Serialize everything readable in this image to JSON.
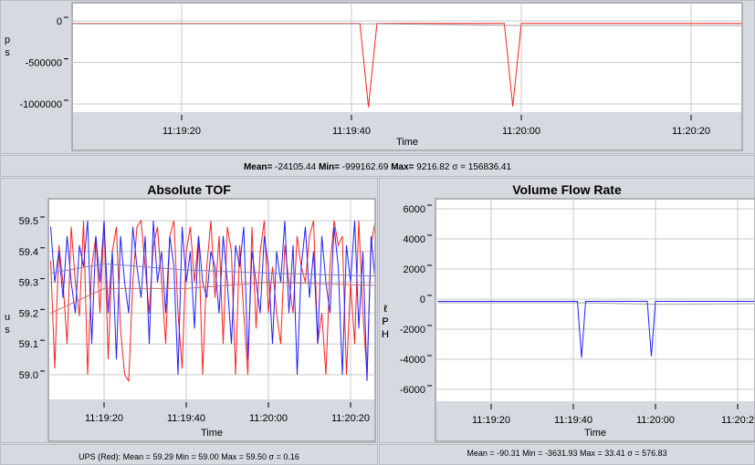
{
  "top_chart": {
    "ylabel": [
      "p",
      "s"
    ],
    "xlabel": "Time",
    "yticks": [
      {
        "v": 0,
        "label": "0"
      },
      {
        "v": -500000,
        "label": "-500000"
      },
      {
        "v": -1000000,
        "label": "-1000000"
      }
    ],
    "xticks": [
      "11:19:20",
      "11:19:40",
      "11:20:00",
      "11:20:20"
    ],
    "stats": {
      "mean_label": "Mean=",
      "mean": "-24105.44",
      "min_label": "Min=",
      "min": "-999162.69",
      "max_label": "Max=",
      "max": "9216.82",
      "sigma_label": "σ =",
      "sigma": "156836.41"
    }
  },
  "tof_chart": {
    "title": "Absolute TOF",
    "ylabel": [
      "u",
      "s"
    ],
    "xlabel": "Time",
    "yticks": [
      {
        "v": 59.5,
        "label": "59.5"
      },
      {
        "v": 59.4,
        "label": "59.4"
      },
      {
        "v": 59.3,
        "label": "59.3"
      },
      {
        "v": 59.2,
        "label": "59.2"
      },
      {
        "v": 59.1,
        "label": "59.1"
      },
      {
        "v": 59.0,
        "label": "59.0"
      }
    ],
    "xticks": [
      "11:19:20",
      "11:19:40",
      "11:20:00",
      "11:20:20"
    ],
    "stats": {
      "series_label": "UPS (Red):",
      "text": "Mean = 59.29 Min = 59.00 Max = 59.50 σ = 0.16"
    }
  },
  "vfr_chart": {
    "title": "Volume Flow Rate",
    "ylabel": [
      "ℓ",
      "P",
      "H"
    ],
    "xlabel": "Time",
    "yticks": [
      {
        "v": 6000,
        "label": "6000"
      },
      {
        "v": 4000,
        "label": "4000"
      },
      {
        "v": 2000,
        "label": "2000"
      },
      {
        "v": 0,
        "label": "0"
      },
      {
        "v": -2000,
        "label": "-2000"
      },
      {
        "v": -4000,
        "label": "-4000"
      },
      {
        "v": -6000,
        "label": "-6000"
      }
    ],
    "xticks": [
      "11:19:20",
      "11:19:40",
      "11:20:00",
      "11:20:2"
    ],
    "stats": {
      "text": "Mean = -90.31 Min = -3631.93 Max = 33.41 σ = 576.83"
    }
  },
  "chart_data": [
    {
      "type": "line",
      "xlabel": "Time",
      "ylabel": "ps",
      "start": "11:19:07",
      "series": [
        {
          "color": "#ff2020",
          "points": [
            [
              "11:19:07",
              -30000
            ],
            [
              "11:19:41",
              -30000
            ],
            [
              "11:19:42",
              -1040000
            ],
            [
              "11:19:43",
              -30000
            ],
            [
              "11:19:58",
              -30000
            ],
            [
              "11:19:59",
              -1030000
            ],
            [
              "11:20:00",
              -30000
            ],
            [
              "11:20:26",
              -30000
            ]
          ]
        },
        {
          "color": "#a0a0a0",
          "points": [
            [
              "11:19:07",
              -35000
            ],
            [
              "11:19:43",
              -35000
            ],
            [
              "11:20:00",
              -55000
            ],
            [
              "11:20:26",
              -55000
            ]
          ]
        }
      ]
    },
    {
      "type": "line",
      "title": "Absolute TOF",
      "xlabel": "Time",
      "ylabel": "us",
      "start": "11:19:07",
      "series": [
        {
          "name": "UPS (Red)",
          "color": "#ff2020",
          "values": [
            59.37,
            59.02,
            59.42,
            59.3,
            59.1,
            59.48,
            59.3,
            59.19,
            59.5,
            59.0,
            59.35,
            59.45,
            59.2,
            59.5,
            59.05,
            59.4,
            59.48,
            59.15,
            59.0,
            58.98,
            59.3,
            59.48,
            59.5,
            59.35,
            59.2,
            59.42,
            59.48,
            59.3,
            59.1,
            59.45,
            59.5,
            59.2,
            59.02,
            59.4,
            59.48,
            59.3,
            59.45,
            59.0,
            59.35,
            59.5,
            59.25,
            59.45,
            59.1,
            59.48,
            59.4,
            59.0,
            59.42,
            59.2,
            59.0,
            59.48,
            59.15,
            59.4,
            59.5,
            59.2,
            59.35,
            59.2,
            59.1,
            59.42,
            59.3,
            59.2,
            59.45,
            59.35,
            59.3,
            59.45,
            59.5,
            59.1,
            59.2,
            59.0,
            59.35,
            59.5,
            59.42,
            59.45,
            59.0,
            59.3,
            59.1,
            59.5,
            59.2,
            59.0,
            59.42,
            59.5
          ]
        },
        {
          "color": "#2020ff",
          "values": [
            59.48,
            59.3,
            59.4,
            59.25,
            59.45,
            59.3,
            59.2,
            59.42,
            59.35,
            59.5,
            59.1,
            59.45,
            59.3,
            59.5,
            59.2,
            59.4,
            59.05,
            59.45,
            59.3,
            59.2,
            59.48,
            59.35,
            59.25,
            59.45,
            59.1,
            59.5,
            59.3,
            59.4,
            59.2,
            59.45,
            59.35,
            59.0,
            59.48,
            59.3,
            59.4,
            59.15,
            59.45,
            59.3,
            59.25,
            59.4,
            59.35,
            59.2,
            59.45,
            59.3,
            59.1,
            59.42,
            59.35,
            59.48,
            59.05,
            59.4,
            59.3,
            59.2,
            59.45,
            59.35,
            59.1,
            59.4,
            59.3,
            59.5,
            59.2,
            59.42,
            59.0,
            59.35,
            59.48,
            59.25,
            59.4,
            59.1,
            59.45,
            59.3,
            59.2,
            59.48,
            59.35,
            59.0,
            59.42,
            59.3,
            59.5,
            59.15,
            59.4,
            58.98,
            59.45,
            59.3
          ]
        },
        {
          "color": "#c07070",
          "points": [
            [
              "11:19:07",
              59.2
            ],
            [
              "11:19:20",
              59.28
            ],
            [
              "11:19:40",
              59.28
            ],
            [
              "11:20:00",
              59.3
            ],
            [
              "11:20:26",
              59.29
            ]
          ]
        },
        {
          "color": "#8080c0",
          "points": [
            [
              "11:19:07",
              59.33
            ],
            [
              "11:19:20",
              59.36
            ],
            [
              "11:19:40",
              59.34
            ],
            [
              "11:20:00",
              59.33
            ],
            [
              "11:20:26",
              59.32
            ]
          ]
        }
      ]
    },
    {
      "type": "line",
      "title": "Volume Flow Rate",
      "xlabel": "Time",
      "ylabel": "ℓPH",
      "start": "11:19:07",
      "series": [
        {
          "color": "#a0a0a0",
          "points": [
            [
              "11:19:07",
              -250
            ],
            [
              "11:19:43",
              -250
            ],
            [
              "11:20:00",
              -350
            ],
            [
              "11:20:26",
              -300
            ]
          ]
        },
        {
          "color": "#2020ff",
          "points": [
            [
              "11:19:07",
              -150
            ],
            [
              "11:19:41",
              -150
            ],
            [
              "11:19:42",
              -3900
            ],
            [
              "11:19:43",
              -150
            ],
            [
              "11:19:58",
              -150
            ],
            [
              "11:19:59",
              -3800
            ],
            [
              "11:20:00",
              -150
            ],
            [
              "11:20:26",
              -150
            ]
          ]
        }
      ]
    }
  ]
}
